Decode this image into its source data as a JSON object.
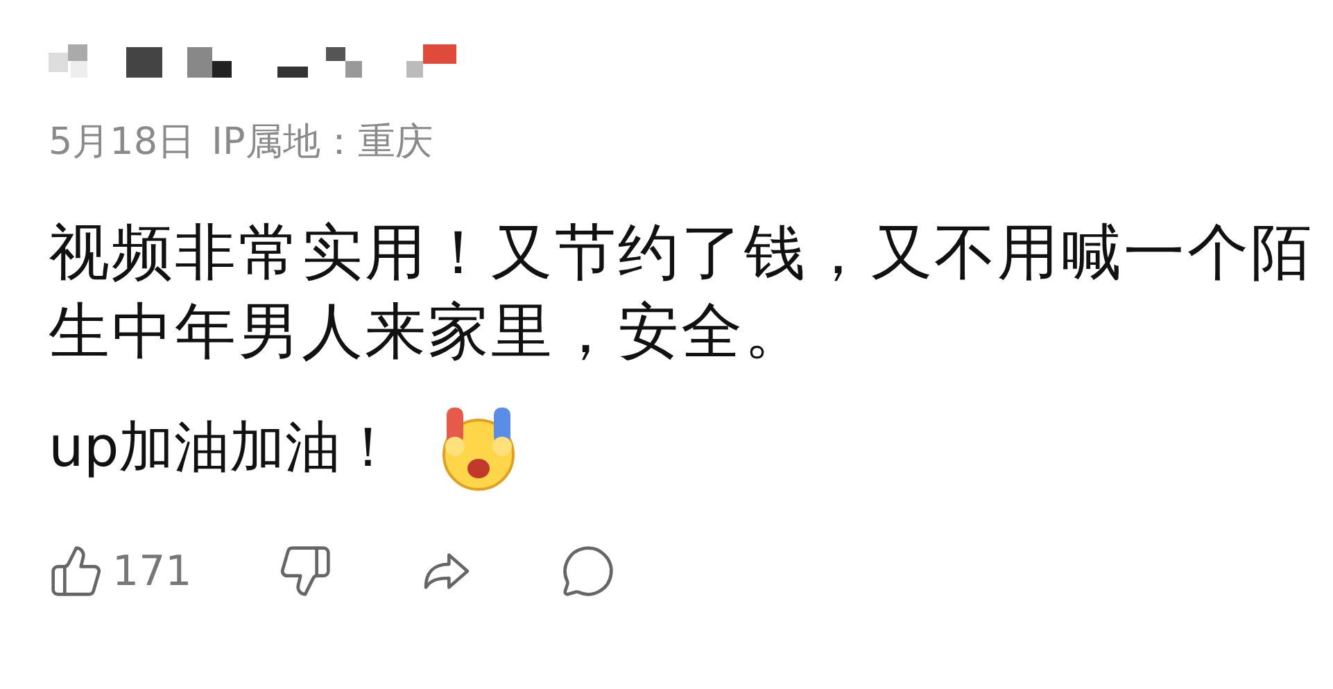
{
  "comment": {
    "date": "5月18日",
    "ip_location": "IP属地：重庆",
    "text": "视频非常实用！又节约了钱，又不用喊一个陌生中年男人来家里，安全。",
    "text_2": "up加油加油！",
    "likes": "171"
  }
}
